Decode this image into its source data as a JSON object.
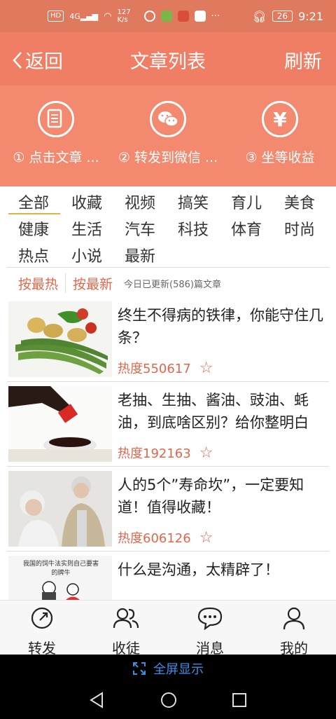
{
  "status_bar": {
    "net_tag": "HD",
    "signal": "4G",
    "speed": "127 K/s",
    "battery": "26",
    "time": "9:21",
    "more": "···"
  },
  "header": {
    "back_label": "返回",
    "title": "文章列表",
    "refresh_label": "刷新"
  },
  "steps": [
    {
      "label": "① 点击文章 ..."
    },
    {
      "label": "② 转发到微信 ..."
    },
    {
      "label": "③ 坐等收益"
    }
  ],
  "categories": [
    "全部",
    "收藏",
    "视频",
    "搞笑",
    "育儿",
    "美食",
    "健康",
    "生活",
    "汽车",
    "科技",
    "体育",
    "时尚",
    "热点",
    "小说",
    "最新"
  ],
  "active_category": "全部",
  "sort": {
    "hot": "按最热",
    "new": "按最新",
    "update_note": "今日已更新(586)篇文章"
  },
  "articles": [
    {
      "title": "终生不得病的铁律，你能守住几条？",
      "heat": "热度550617"
    },
    {
      "title": "老抽、生抽、酱油、豉油、蚝油，到底啥区别？给你整明白",
      "heat": "热度192163"
    },
    {
      "title": "人的5个”寿命坎”，一定要知道！值得收藏！",
      "heat": "热度606126"
    },
    {
      "title": "什么是沟通，太精辟了！",
      "heat": ""
    }
  ],
  "article4_thumb_text": "我国的饲牛法实则自己要害的牌牛",
  "tabs": [
    {
      "label": "转发",
      "icon": "share-icon"
    },
    {
      "label": "收徒",
      "icon": "users-icon"
    },
    {
      "label": "消息",
      "icon": "message-icon"
    },
    {
      "label": "我的",
      "icon": "user-icon"
    }
  ],
  "fullscreen_label": "全屏显示",
  "colors": {
    "status": "#e07a5e",
    "header": "#ef7e64",
    "steps_bg": "#f3896f",
    "accent": "#e0674c",
    "underline": "#e7b046"
  }
}
